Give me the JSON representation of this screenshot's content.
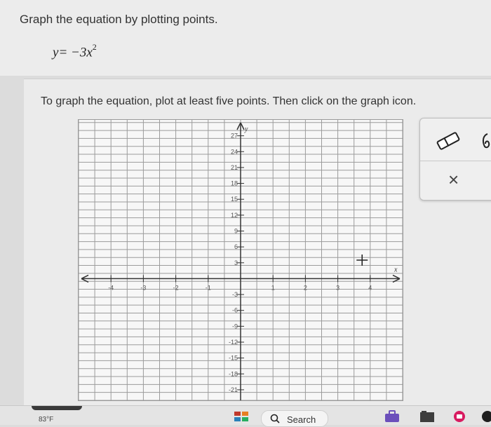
{
  "question": {
    "prompt": "Graph the equation by plotting points.",
    "equation_lhs": "y",
    "equation_rhs": "= −3x",
    "equation_exponent": "2"
  },
  "work_area": {
    "instruction": "To graph the equation, plot at least five points. Then click on the graph icon."
  },
  "graph": {
    "x_axis_label": "x",
    "y_axis_label": "y",
    "x_range": [
      -5,
      5
    ],
    "y_range": [
      -23,
      30
    ],
    "x_ticks": [
      -4,
      -3,
      -2,
      -1,
      1,
      2,
      3,
      4
    ],
    "y_ticks": [
      27,
      24,
      21,
      18,
      15,
      12,
      9,
      6,
      3,
      -3,
      -6,
      -9,
      -12,
      -15,
      -18,
      -21
    ],
    "x_tick_labels": [
      "-4",
      "-3",
      "-2",
      "-1",
      "1",
      "2",
      "3",
      "4"
    ],
    "y_tick_labels": [
      "27",
      "24",
      "21",
      "18",
      "15",
      "12",
      "9",
      "6",
      "3",
      "-3",
      "-6",
      "-9",
      "-12",
      "-15",
      "-18",
      "-21"
    ],
    "vertical_grid_step": 0.5,
    "horizontal_grid_step": 1.5,
    "cursor_position": {
      "x": 3.75,
      "y": 3.5
    }
  },
  "tools": {
    "eraser_icon": "eraser-icon",
    "close_icon": "close-icon",
    "close_symbol": "×"
  },
  "taskbar": {
    "weather": "83°F",
    "search_label": "Search"
  }
}
